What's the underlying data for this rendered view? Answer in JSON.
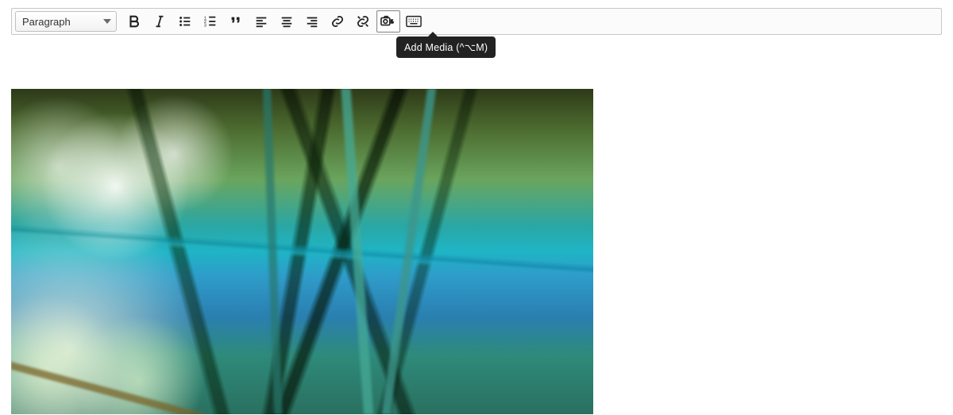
{
  "toolbar": {
    "format_selected": "Paragraph",
    "buttons": {
      "bold": {
        "name": "bold-button",
        "icon": "bold-icon"
      },
      "italic": {
        "name": "italic-button",
        "icon": "italic-icon"
      },
      "bullets": {
        "name": "bulleted-list-button",
        "icon": "bulleted-list-icon"
      },
      "numbered": {
        "name": "numbered-list-button",
        "icon": "numbered-list-icon"
      },
      "blockquote": {
        "name": "blockquote-button",
        "icon": "blockquote-icon"
      },
      "align_left": {
        "name": "align-left-button",
        "icon": "align-left-icon"
      },
      "align_center": {
        "name": "align-center-button",
        "icon": "align-center-icon"
      },
      "align_right": {
        "name": "align-right-button",
        "icon": "align-right-icon"
      },
      "link": {
        "name": "link-button",
        "icon": "link-icon"
      },
      "unlink": {
        "name": "unlink-button",
        "icon": "unlink-icon"
      },
      "add_media": {
        "name": "add-media-button",
        "icon": "camera-media-icon",
        "active": true
      },
      "keyboard": {
        "name": "keyboard-shortcuts-button",
        "icon": "keyboard-icon"
      }
    }
  },
  "tooltip": {
    "text": "Add Media (^⌥M)"
  },
  "content": {
    "image_alt": "inserted-media-image"
  }
}
